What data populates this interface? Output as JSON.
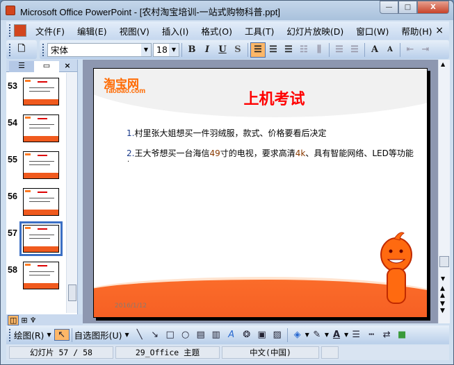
{
  "window": {
    "title": "Microsoft Office PowerPoint - [农村淘宝培训-一站式购物科普.ppt]",
    "min": "—",
    "max": "□",
    "close": "X"
  },
  "menu": [
    "文件(F)",
    "编辑(E)",
    "视图(V)",
    "插入(I)",
    "格式(O)",
    "工具(T)",
    "幻灯片放映(D)",
    "窗口(W)",
    "帮助(H)"
  ],
  "menu_close": "×",
  "format": {
    "font": "宋体",
    "size": "18",
    "bold": "B",
    "italic": "I",
    "underline": "U",
    "shadow": "S",
    "grow": "A",
    "shrink": "A"
  },
  "outline_panel": {
    "close": "×",
    "slides": [
      {
        "num": "53"
      },
      {
        "num": "54"
      },
      {
        "num": "55"
      },
      {
        "num": "56"
      },
      {
        "num": "57",
        "selected": true
      },
      {
        "num": "58"
      }
    ]
  },
  "slide": {
    "brand": "淘宝网",
    "brand_sub": "Taobao.com",
    "title": "上机考试",
    "item1_num": "1.",
    "item1": "村里张大姐想买一件羽绒服，款式、价格要看后决定",
    "item2_num": "2.",
    "item2_a": "王大爷想买一台海信",
    "item2_b": "49",
    "item2_c": "寸的电视，要求高清",
    "item2_d": "4k",
    "item2_e": "、具有智能网络、LED等功能",
    "dot": ".",
    "date": "2016/1/12"
  },
  "draw": {
    "draw_label": "绘图(R)",
    "autoshape_label": "自选图形(U)"
  },
  "status": {
    "slide": "幻灯片 57 / 58",
    "theme": "29_Office 主题",
    "lang": "中文(中国)"
  },
  "colors": {
    "accent": "#ff6a00",
    "title_red": "#ff0000"
  }
}
